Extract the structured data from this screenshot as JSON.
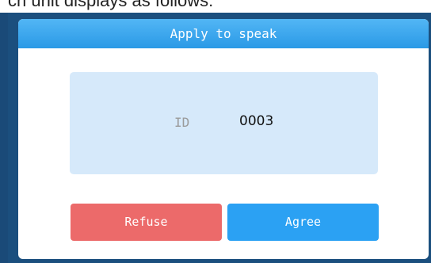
{
  "background_text": "ch unit displays as follows:",
  "dialog": {
    "title": "Apply to speak",
    "id_label": "ID",
    "id_value": "0003",
    "refuse_label": "Refuse",
    "agree_label": "Agree"
  },
  "colors": {
    "header": "#2a99e6",
    "panel": "#d6e9fa",
    "refuse": "#ec6a6a",
    "agree": "#2ba1f3",
    "frame": "#1b4f7e"
  }
}
